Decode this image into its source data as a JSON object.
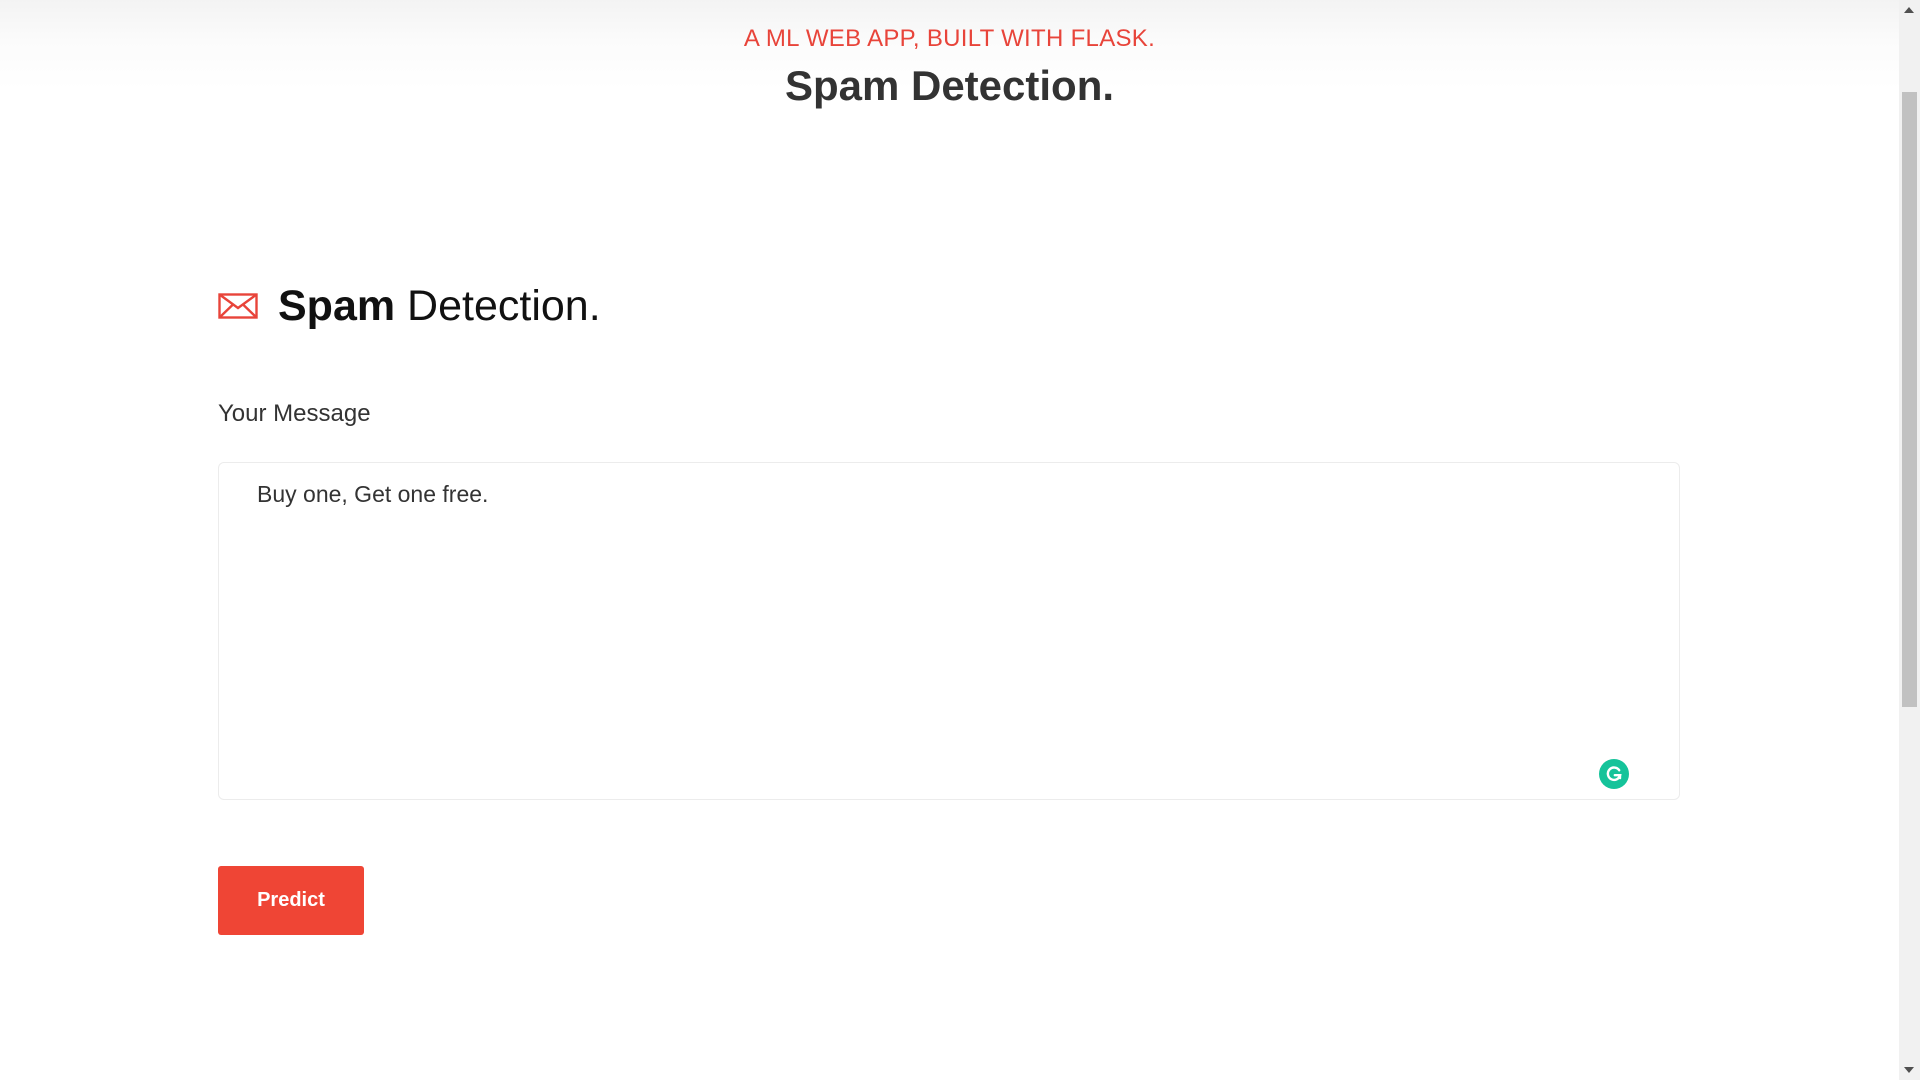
{
  "header": {
    "eyebrow": "A ML WEB APP, BUILT WITH FLASK.",
    "title": "Spam Detection."
  },
  "section": {
    "icon": "envelope-icon",
    "heading_bold": "Spam",
    "heading_rest": " Detection."
  },
  "form": {
    "message_label": "Your Message",
    "message_value": "Buy one, Get one free.",
    "predict_label": "Predict"
  },
  "extensions": {
    "grammarly_icon": "grammarly-icon"
  },
  "colors": {
    "accent": "#e8443a",
    "button": "#ef4535",
    "grammarly": "#15c39a"
  }
}
